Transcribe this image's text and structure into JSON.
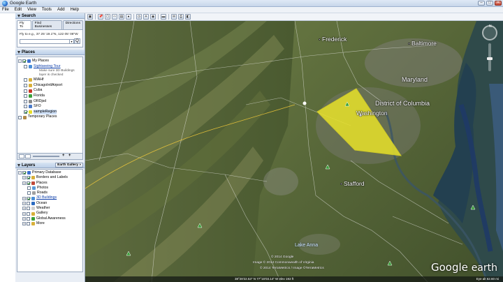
{
  "window": {
    "title": "Google Earth",
    "min": "–",
    "max": "□",
    "close": "×"
  },
  "menu": [
    "File",
    "Edit",
    "View",
    "Tools",
    "Add",
    "Help"
  ],
  "search": {
    "header": "Search",
    "tabs": [
      "Fly To",
      "Find Businesses",
      "Directions"
    ],
    "hint": "Fly to e.g., 37 25' 19.1\"N, 122 05' 06\"W",
    "go": "Q",
    "dropdown": "▾"
  },
  "places": {
    "header": "Places",
    "items": [
      {
        "label": "My Places",
        "checked": true,
        "icon_color": "#3b6fd0",
        "indent": 0,
        "expander": "−"
      },
      {
        "label": "Sightseeing Tour",
        "checked": false,
        "icon_color": "#4a8ed8",
        "indent": 1,
        "link": true,
        "expander": ""
      },
      {
        "label": "MIAHf",
        "checked": false,
        "icon_color": "#d8b03a",
        "indent": 1,
        "expander": ""
      },
      {
        "label": "ChicagoIntlAirport",
        "checked": false,
        "icon_color": "#d8b03a",
        "indent": 1,
        "expander": ""
      },
      {
        "label": "Cuba",
        "checked": false,
        "icon_color": "#c93a2a",
        "indent": 1,
        "expander": ""
      },
      {
        "label": "Florida",
        "checked": false,
        "icon_color": "#3aa03a",
        "indent": 1,
        "expander": ""
      },
      {
        "label": "ORDjsd",
        "checked": false,
        "icon_color": "#8a8a8a",
        "indent": 1,
        "expander": ""
      },
      {
        "label": "SFO",
        "checked": false,
        "icon_color": "#4a7ac8",
        "indent": 1,
        "expander": ""
      },
      {
        "label": "sampleRegion",
        "checked": true,
        "icon_color": "#e6dd2a",
        "indent": 1,
        "selected": true,
        "expander": ""
      },
      {
        "label": "Temporary Places",
        "checked": false,
        "icon_color": "#b08a4a",
        "indent": 0,
        "expander": ""
      }
    ],
    "sightseeing_desc": [
      "Make sure 3D Buildings",
      "layer is checked"
    ],
    "toolbar": {
      "add": "+",
      "remove": "+"
    }
  },
  "layers": {
    "header": "Layers",
    "gallery_button": "Earth Gallery »",
    "items": [
      {
        "label": "Primary Database",
        "checked": true,
        "icon_color": "#3b6fd0",
        "indent": 0,
        "expander": "−"
      },
      {
        "label": "Borders and Labels",
        "checked": true,
        "icon_color": "#d8b03a",
        "indent": 1,
        "expander": "+"
      },
      {
        "label": "Places",
        "checked": true,
        "icon_color": "#c04a3a",
        "indent": 1,
        "expander": "+"
      },
      {
        "label": "Photos",
        "checked": false,
        "icon_color": "#5a9ad8",
        "indent": 1,
        "expander": ""
      },
      {
        "label": "Roads",
        "checked": false,
        "icon_color": "#a0a0a0",
        "indent": 1,
        "expander": ""
      },
      {
        "label": "3D Buildings",
        "checked": true,
        "icon_color": "#4a8ed8",
        "indent": 1,
        "expander": "+",
        "link": true
      },
      {
        "label": "Ocean",
        "checked": false,
        "icon_color": "#2a6ac0",
        "indent": 1,
        "expander": "+"
      },
      {
        "label": "Weather",
        "checked": false,
        "icon_color": "#d0d0d0",
        "indent": 1,
        "expander": "+"
      },
      {
        "label": "Gallery",
        "checked": false,
        "icon_color": "#d8b03a",
        "indent": 1,
        "expander": "+"
      },
      {
        "label": "Global Awareness",
        "checked": false,
        "icon_color": "#3aa03a",
        "indent": 1,
        "expander": "+"
      },
      {
        "label": "More",
        "checked": false,
        "icon_color": "#d8b03a",
        "indent": 1,
        "expander": "+"
      }
    ]
  },
  "toolbar_icons": [
    "hide-sidebar",
    "placemark",
    "polygon",
    "path",
    "image-overlay",
    "record-tour",
    "historical-imagery",
    "sun",
    "planets",
    "ruler",
    "email",
    "print",
    "view-in-maps"
  ],
  "map": {
    "cities": [
      {
        "name": "Frederick"
      },
      {
        "name": "Baltimore"
      },
      {
        "name": "Washington"
      },
      {
        "name": "Stafford"
      }
    ],
    "regions": [
      {
        "name": "Maryland"
      },
      {
        "name": "District of Columbia"
      }
    ],
    "water": [
      {
        "name": "Lake Anna"
      }
    ],
    "compass_label": "N",
    "copyright": [
      "© 2014 Google",
      "Image © 2014 Commonwealth of Virginia",
      "© 2014 TerraMetrics / Image ©TerraMetrics"
    ],
    "status_position": "38°28'22.53\" N  77°15'03.14\" W  elev 192 ft",
    "eye_alt": "Eye alt 62.60 mi",
    "logo_primary": "Google",
    "logo_secondary": "earth"
  }
}
